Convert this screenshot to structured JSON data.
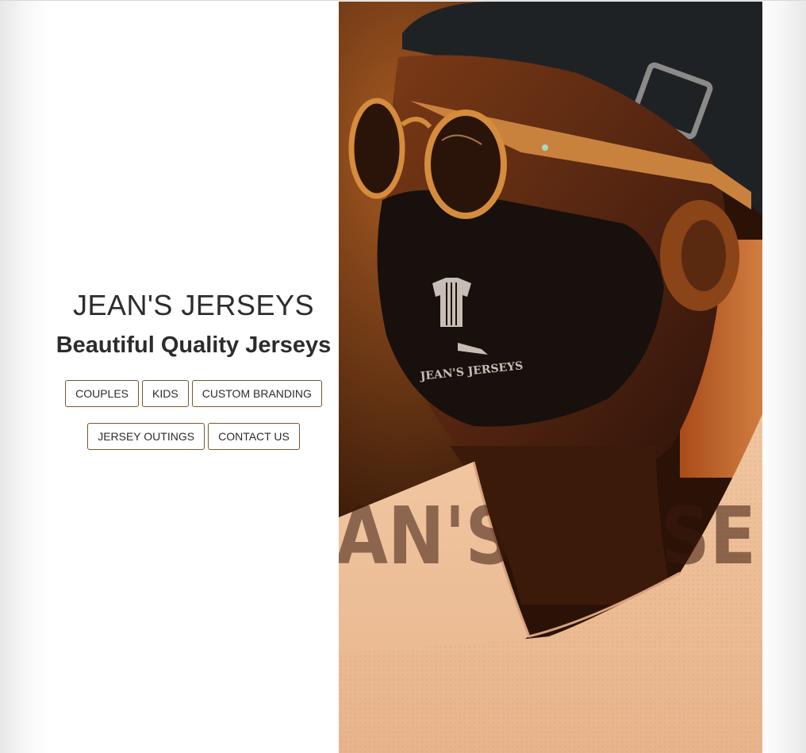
{
  "brand": {
    "title": "JEAN'S JERSEYS",
    "tagline": "Beautiful Quality Jerseys"
  },
  "nav": {
    "row1": [
      "COUPLES",
      "KIDS",
      "CUSTOM BRANDING"
    ],
    "row2": [
      "JERSEY OUTINGS",
      "CONTACT US"
    ]
  },
  "hero": {
    "mask_logo_text": "JEAN'S JERSEYS",
    "overlay_text": "AN'S JERSE"
  },
  "colors": {
    "button_border": "#7a5530",
    "text": "#2c2c2c",
    "hero_warm": "#d9884a"
  }
}
